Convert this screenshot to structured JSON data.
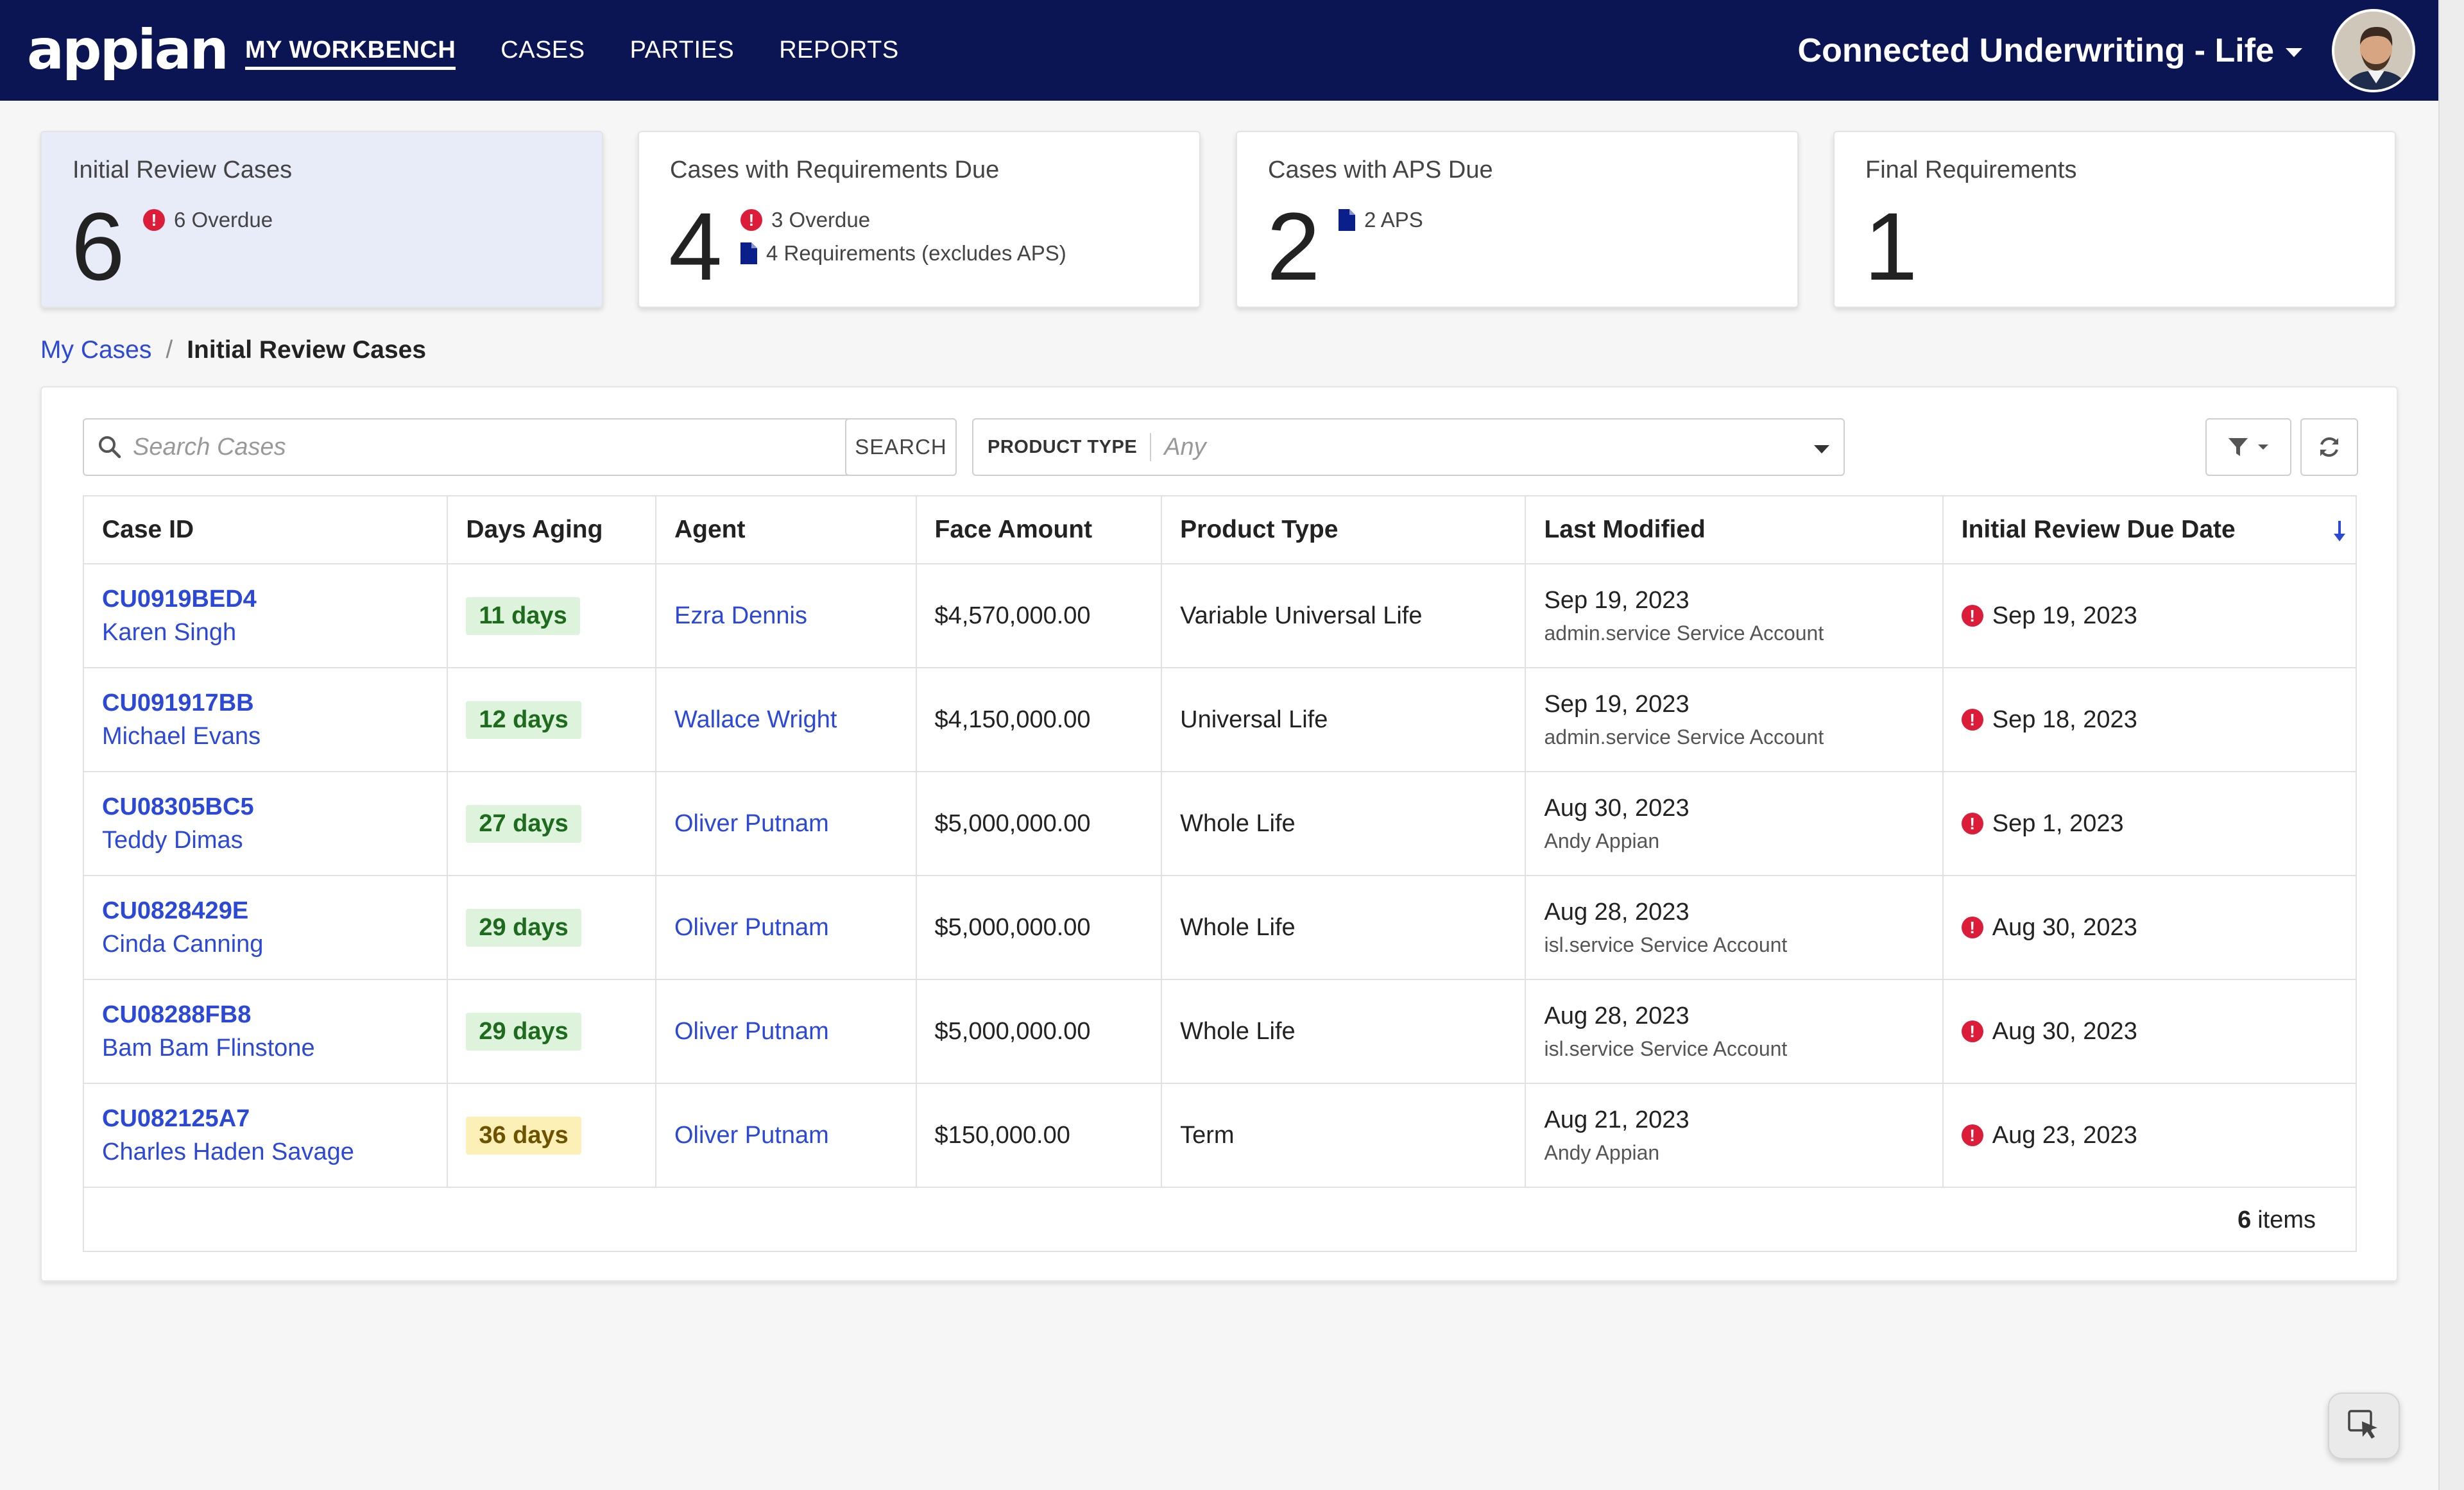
{
  "header": {
    "logo": "appian",
    "nav": [
      "MY WORKBENCH",
      "CASES",
      "PARTIES",
      "REPORTS"
    ],
    "app_title": "Connected Underwriting - Life",
    "avatar_icon": "user-avatar"
  },
  "kpis": [
    {
      "title": "Initial Review Cases",
      "count": "6",
      "lines": [
        {
          "icon": "alert",
          "text": "6 Overdue"
        }
      ]
    },
    {
      "title": "Cases with Requirements Due",
      "count": "4",
      "lines": [
        {
          "icon": "alert",
          "text": "3 Overdue"
        },
        {
          "icon": "document",
          "text": "4 Requirements (excludes APS)"
        }
      ]
    },
    {
      "title": "Cases with APS Due",
      "count": "2",
      "lines": [
        {
          "icon": "document",
          "text": "2 APS"
        }
      ]
    },
    {
      "title": "Final Requirements",
      "count": "1",
      "lines": []
    }
  ],
  "breadcrumb": {
    "parent": "My Cases",
    "separator": "/",
    "current": "Initial Review Cases"
  },
  "toolbar": {
    "search_placeholder": "Search Cases",
    "search_button": "SEARCH",
    "product_type_label": "PRODUCT TYPE",
    "product_type_value": "Any"
  },
  "table": {
    "columns": [
      "Case ID",
      "Days Aging",
      "Agent",
      "Face Amount",
      "Product Type",
      "Last Modified",
      "Initial Review Due Date"
    ],
    "rows": [
      {
        "case_id": "CU0919BED4",
        "name": "Karen Singh",
        "days": "11 days",
        "days_level": "green",
        "agent": "Ezra Dennis",
        "face_amount": "$4,570,000.00",
        "product_type": "Variable Universal Life",
        "modified_date": "Sep 19, 2023",
        "modified_by": "admin.service Service Account",
        "due_date": "Sep 19, 2023"
      },
      {
        "case_id": "CU091917BB",
        "name": "Michael Evans",
        "days": "12 days",
        "days_level": "green",
        "agent": "Wallace Wright",
        "face_amount": "$4,150,000.00",
        "product_type": "Universal Life",
        "modified_date": "Sep 19, 2023",
        "modified_by": "admin.service Service Account",
        "due_date": "Sep 18, 2023"
      },
      {
        "case_id": "CU08305BC5",
        "name": "Teddy Dimas",
        "days": "27 days",
        "days_level": "green",
        "agent": "Oliver Putnam",
        "face_amount": "$5,000,000.00",
        "product_type": "Whole Life",
        "modified_date": "Aug 30, 2023",
        "modified_by": "Andy Appian",
        "due_date": "Sep 1, 2023"
      },
      {
        "case_id": "CU0828429E",
        "name": "Cinda Canning",
        "days": "29 days",
        "days_level": "green",
        "agent": "Oliver Putnam",
        "face_amount": "$5,000,000.00",
        "product_type": "Whole Life",
        "modified_date": "Aug 28, 2023",
        "modified_by": "isl.service Service Account",
        "due_date": "Aug 30, 2023"
      },
      {
        "case_id": "CU08288FB8",
        "name": "Bam Bam Flinstone",
        "days": "29 days",
        "days_level": "green",
        "agent": "Oliver Putnam",
        "face_amount": "$5,000,000.00",
        "product_type": "Whole Life",
        "modified_date": "Aug 28, 2023",
        "modified_by": "isl.service Service Account",
        "due_date": "Aug 30, 2023"
      },
      {
        "case_id": "CU082125A7",
        "name": "Charles Haden Savage",
        "days": "36 days",
        "days_level": "yellow",
        "agent": "Oliver Putnam",
        "face_amount": "$150,000.00",
        "product_type": "Term",
        "modified_date": "Aug 21, 2023",
        "modified_by": "Andy Appian",
        "due_date": "Aug 23, 2023"
      }
    ],
    "footer_count": "6",
    "footer_label": "items"
  },
  "colors": {
    "header_bg": "#0b1554",
    "link": "#2b48d6",
    "alert": "#dc1d3a",
    "doc": "#0b1f8a",
    "selected_card": "#e8ebf8"
  },
  "icons": {
    "search": "search-icon",
    "filter": "filter-icon",
    "refresh": "refresh-icon",
    "sort": "sort-down-arrow-icon",
    "fab": "cursor-select-icon"
  }
}
